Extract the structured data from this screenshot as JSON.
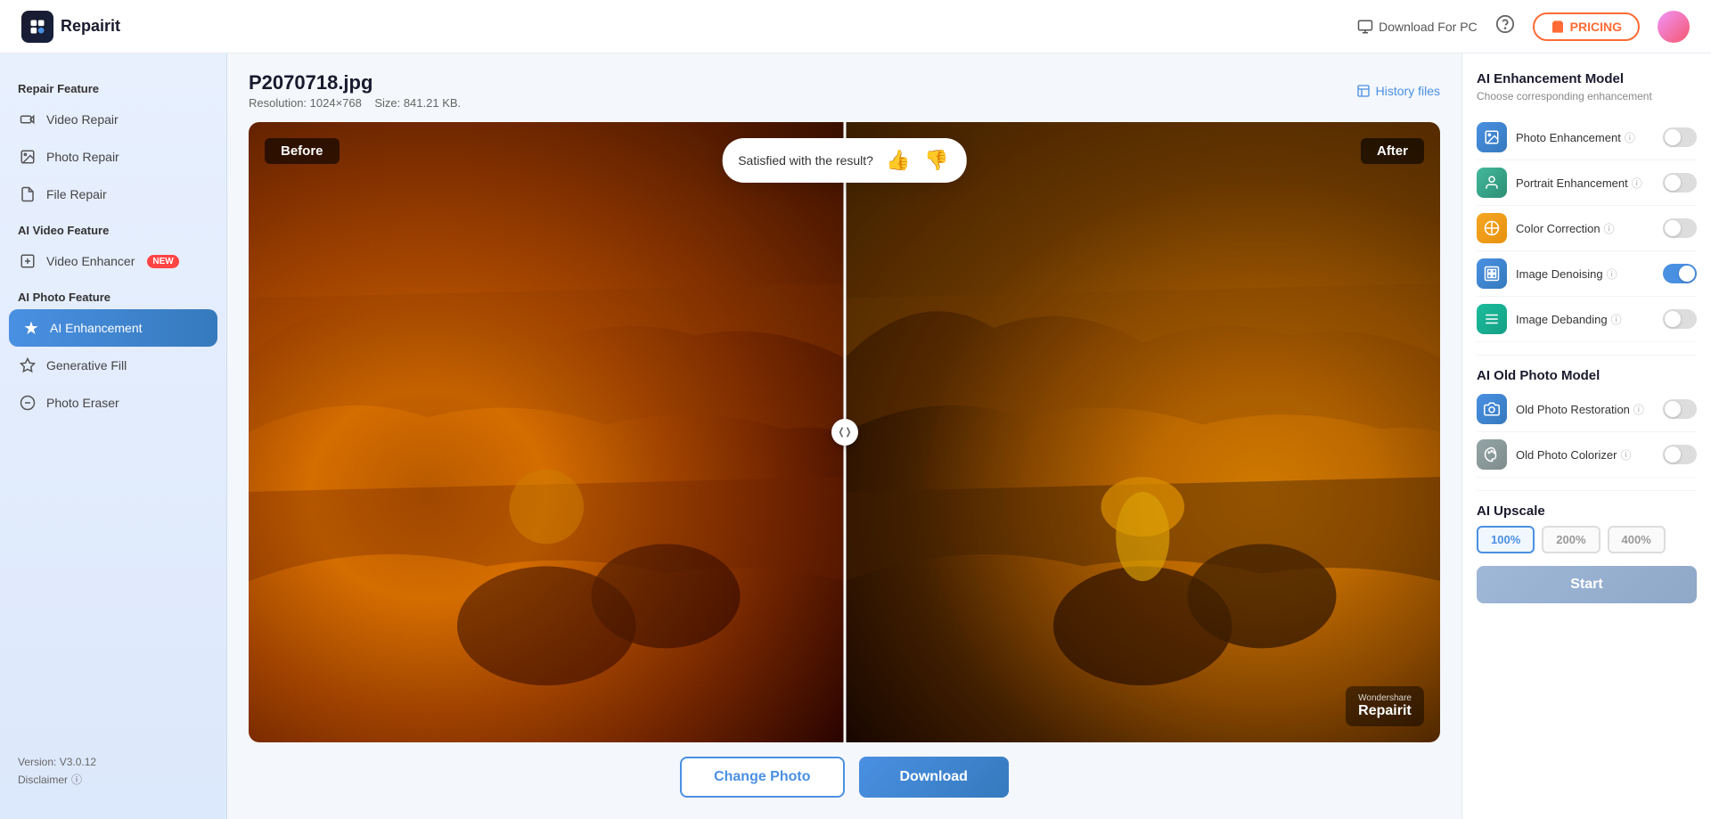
{
  "app": {
    "name": "Repairit"
  },
  "nav": {
    "download_pc": "Download For PC",
    "pricing": "PRICING"
  },
  "sidebar": {
    "repair_feature_label": "Repair Feature",
    "items_repair": [
      {
        "id": "video-repair",
        "label": "Video Repair",
        "icon": "▶"
      },
      {
        "id": "photo-repair",
        "label": "Photo Repair",
        "icon": "🖼"
      },
      {
        "id": "file-repair",
        "label": "File Repair",
        "icon": "📄"
      }
    ],
    "ai_video_label": "AI Video Feature",
    "items_ai_video": [
      {
        "id": "video-enhancer",
        "label": "Video Enhancer",
        "icon": "🎞",
        "badge": "NEW"
      }
    ],
    "ai_photo_label": "AI Photo Feature",
    "items_ai_photo": [
      {
        "id": "ai-enhancement",
        "label": "AI Enhancement",
        "icon": "✨",
        "active": true
      },
      {
        "id": "generative-fill",
        "label": "Generative Fill",
        "icon": "◇"
      },
      {
        "id": "photo-eraser",
        "label": "Photo Eraser",
        "icon": "◯"
      }
    ],
    "version": "Version: V3.0.12",
    "disclaimer": "Disclaimer"
  },
  "file": {
    "name": "P2070718.jpg",
    "resolution": "Resolution: 1024×768",
    "size": "Size: 841.21 KB."
  },
  "history_btn": "History files",
  "viewer": {
    "label_before": "Before",
    "label_after": "After",
    "satisfaction_text": "Satisfied with the result?",
    "watermark_sub": "Wondershare",
    "watermark_brand": "Repairit"
  },
  "actions": {
    "change_photo": "Change Photo",
    "download": "Download"
  },
  "right_panel": {
    "ai_enhancement_title": "AI Enhancement Model",
    "ai_enhancement_subtitle": "Choose corresponding enhancement",
    "enhancements": [
      {
        "id": "photo-enhancement",
        "label": "Photo Enhancement",
        "icon": "🖼",
        "color": "blue",
        "enabled": false
      },
      {
        "id": "portrait-enhancement",
        "label": "Portrait Enhancement",
        "icon": "👤",
        "color": "green",
        "enabled": false
      },
      {
        "id": "color-correction",
        "label": "Color Correction",
        "icon": "🎨",
        "color": "orange",
        "enabled": false
      },
      {
        "id": "image-denoising",
        "label": "Image Denoising",
        "icon": "🔲",
        "color": "blue",
        "enabled": true
      },
      {
        "id": "image-debanding",
        "label": "Image Debanding",
        "icon": "〰",
        "color": "teal",
        "enabled": false
      }
    ],
    "old_photo_title": "AI Old Photo Model",
    "old_photo_items": [
      {
        "id": "old-photo-restoration",
        "label": "Old Photo Restoration",
        "icon": "📷",
        "color": "blue",
        "enabled": false
      },
      {
        "id": "old-photo-colorizer",
        "label": "Old Photo Colorizer",
        "icon": "🎭",
        "color": "gray",
        "enabled": false
      }
    ],
    "upscale_title": "AI Upscale",
    "upscale_options": [
      {
        "value": "100%",
        "active": true
      },
      {
        "value": "200%",
        "active": false
      },
      {
        "value": "400%",
        "active": false
      }
    ],
    "start_btn": "Start"
  }
}
